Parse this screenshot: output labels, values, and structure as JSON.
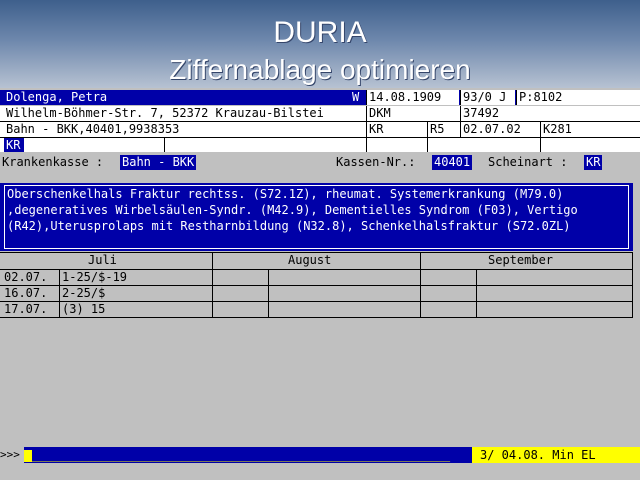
{
  "banner": {
    "title": "DURIA",
    "subtitle": "Ziffernablage optimieren"
  },
  "patient": {
    "name": "Dolenga, Petra",
    "sex": "W",
    "birthdate": "14.08.1909",
    "age": "93/0 J",
    "pnr": "P:8102",
    "street": "Wilhelm-Böhmer-Str. 7, 52372 Krauzau-Bilstei",
    "ins_code": "DKM",
    "ins_number": "37492",
    "kasse": "Bahn - BKK,40401,9938353",
    "status_kr": "KR",
    "status_r5": "R5",
    "valid_date": "02.07.02",
    "k_code": "K281",
    "kr_extra": "KR"
  },
  "fields": {
    "krankenkasse_label": "Krankenkasse :",
    "krankenkasse_value": "Bahn - BKK",
    "kassen_nr_label": "Kassen-Nr.:",
    "kassen_nr_value": "40401",
    "scheinart_label": "Scheinart :",
    "scheinart_value": "KR"
  },
  "diagnoses": "Oberschenkelhals Fraktur rechtss. (S72.1Z), rheumat. Systemerkrankung (M79.0)\n,degeneratives Wirbelsäulen-Syndr. (M42.9), Dementielles Syndrom (F03), Vertigo (R42),Uterusprolaps mit Restharnbildung (N32.8), Schenkelhalsfraktur (S72.0ZL)",
  "months": [
    "Juli",
    "August",
    "September"
  ],
  "entries": [
    {
      "date": "02.07.",
      "code": "1-25/$-19"
    },
    {
      "date": "16.07.",
      "code": "2-25/$"
    },
    {
      "date": "17.07.",
      "code": "(3) 15"
    }
  ],
  "command": {
    "prompt": ">>>",
    "dashes": "___________________________________________________________________",
    "status": "3/ 04.08. Min EL"
  }
}
